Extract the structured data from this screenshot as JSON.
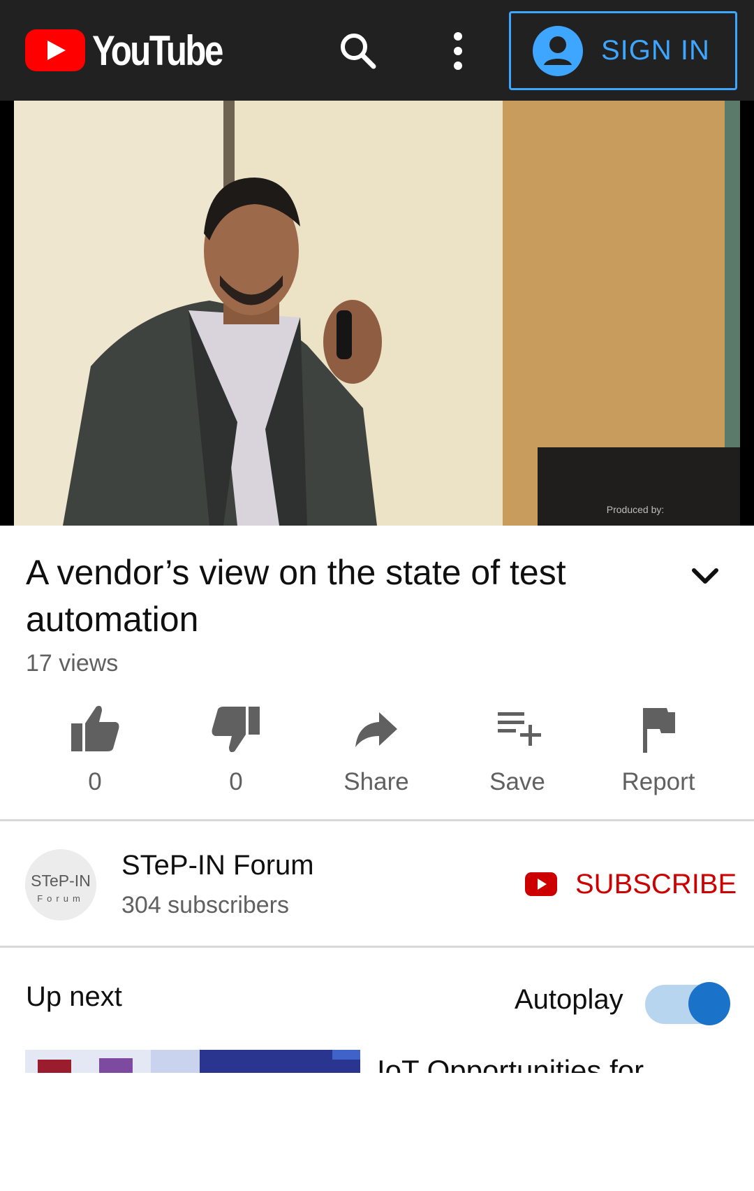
{
  "header": {
    "logo_text": "YouTube",
    "sign_in_label": "SIGN IN",
    "icons": [
      "youtube-logo-icon",
      "search-icon",
      "more-vert-icon",
      "account-circle-icon"
    ],
    "colors": {
      "background": "#212121",
      "brand_red": "#ff0000",
      "sign_in_blue": "#3ea6ff"
    }
  },
  "video": {
    "title": "A vendor’s view on the state of test automation",
    "views": "17 views"
  },
  "actions": [
    {
      "icon": "thumb-up-icon",
      "label": "0"
    },
    {
      "icon": "thumb-down-icon",
      "label": "0"
    },
    {
      "icon": "share-icon",
      "label": "Share"
    },
    {
      "icon": "playlist-add-icon",
      "label": "Save"
    },
    {
      "icon": "flag-icon",
      "label": "Report"
    }
  ],
  "channel": {
    "name": "STeP-IN Forum",
    "subscribers": "304 subscribers",
    "avatar_logo_text": "STeP-IN Forum",
    "subscribe_label": "SUBSCRIBE",
    "subscribe_color": "#cc0000"
  },
  "up_next": {
    "heading": "Up next",
    "autoplay_label": "Autoplay",
    "autoplay_on": true,
    "items": [
      {
        "title": "IoT Opportunities for"
      }
    ]
  }
}
